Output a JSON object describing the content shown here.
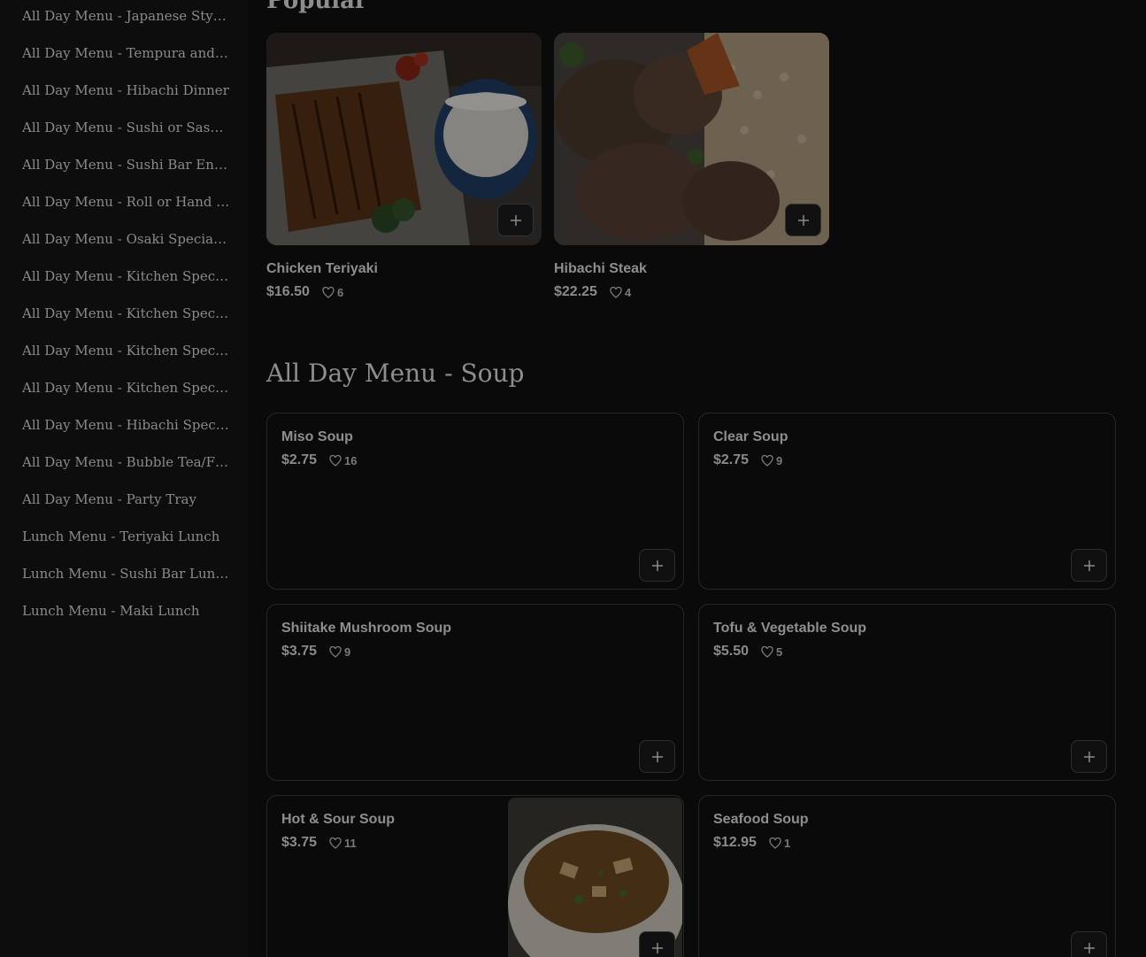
{
  "sidebar": {
    "items": [
      {
        "label": "All Day Menu - Japanese Style ..."
      },
      {
        "label": "All Day Menu - Tempura and ..."
      },
      {
        "label": "All Day Menu - Hibachi Dinner"
      },
      {
        "label": "All Day Menu - Sushi or Sashi..."
      },
      {
        "label": "All Day Menu - Sushi Bar Entr..."
      },
      {
        "label": "All Day Menu - Roll or Hand R..."
      },
      {
        "label": "All Day Menu - Osaki Special ..."
      },
      {
        "label": "All Day Menu - Kitchen Speci..."
      },
      {
        "label": "All Day Menu - Kitchen Speci..."
      },
      {
        "label": "All Day Menu - Kitchen Speci..."
      },
      {
        "label": "All Day Menu - Kitchen Speci..."
      },
      {
        "label": "All Day Menu - Hibachi Special"
      },
      {
        "label": "All Day Menu - Bubble Tea/Fr..."
      },
      {
        "label": "All Day Menu - Party Tray"
      },
      {
        "label": "Lunch Menu - Teriyaki Lunch"
      },
      {
        "label": "Lunch Menu - Sushi Bar Lunc..."
      },
      {
        "label": "Lunch Menu - Maki Lunch"
      }
    ]
  },
  "popular": {
    "title": "Popular",
    "items": [
      {
        "name": "Chicken Teriyaki",
        "price": "$16.50",
        "likes": "6",
        "image": "chicken-teriyaki-photo"
      },
      {
        "name": "Hibachi Steak",
        "price": "$22.25",
        "likes": "4",
        "image": "hibachi-steak-photo"
      }
    ]
  },
  "soup": {
    "title": "All Day Menu - Soup",
    "items": [
      {
        "name": "Miso Soup",
        "price": "$2.75",
        "likes": "16"
      },
      {
        "name": "Clear Soup",
        "price": "$2.75",
        "likes": "9"
      },
      {
        "name": "Shiitake Mushroom Soup",
        "price": "$3.75",
        "likes": "9"
      },
      {
        "name": "Tofu & Vegetable Soup",
        "price": "$5.50",
        "likes": "5"
      },
      {
        "name": "Hot & Sour Soup",
        "price": "$3.75",
        "likes": "11",
        "image": "hot-sour-soup-photo"
      },
      {
        "name": "Seafood Soup",
        "price": "$12.95",
        "likes": "1"
      }
    ]
  },
  "icons": {
    "like": "heart-icon",
    "add": "plus-icon"
  },
  "colors": {
    "background": "#0a0a0a",
    "card_border": "#262626",
    "text": "#8e8e8e"
  }
}
